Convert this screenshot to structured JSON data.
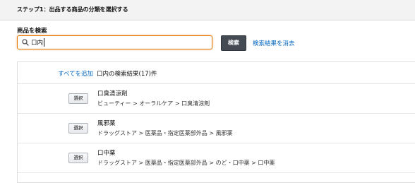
{
  "step": {
    "title": "ステップ1：出品する商品の分類を選択する"
  },
  "search": {
    "label": "商品を検索",
    "value": "口内",
    "button": "検索",
    "clear_link": "検索結果を消去"
  },
  "results": {
    "add_all": "すべてを追加",
    "summary": "口内の検索結果(17)件",
    "select_label": "選択",
    "items": [
      {
        "name": "口臭清涼剤",
        "path": "ビューティー > オーラルケア > 口臭清涼剤"
      },
      {
        "name": "風邪薬",
        "path": "ドラッグストア > 医薬品・指定医薬部外品 > 風邪薬"
      },
      {
        "name": "口中薬",
        "path": "ドラッグストア > 医薬品・指定医薬部外品 > のど・口中薬 > 口中薬"
      }
    ]
  },
  "colors": {
    "accent_focus": "#e77600",
    "link": "#0066c0",
    "button_dark": "#444b53"
  },
  "icons": {
    "search": "magnifier-icon"
  }
}
